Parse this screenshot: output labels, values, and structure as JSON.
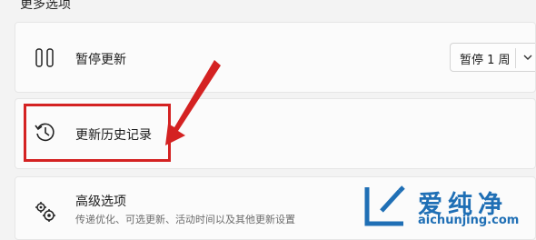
{
  "section": {
    "title": "更多选项"
  },
  "pause_updates": {
    "icon": "pause-icon",
    "label": "暂停更新",
    "dropdown_value": "暂停 1 周",
    "dropdown_icon": "chevron-down-icon"
  },
  "update_history": {
    "icon": "history-icon",
    "label": "更新历史记录"
  },
  "advanced_options": {
    "icon": "gears-icon",
    "label": "高级选项",
    "description": "传递优化、可选更新、活动时间以及其他更新设置"
  },
  "annotation": {
    "highlight_color": "#d42222"
  },
  "watermark": {
    "brand": "爱纯净",
    "domain": "aichunjing.com",
    "color": "#1f6fb5"
  }
}
